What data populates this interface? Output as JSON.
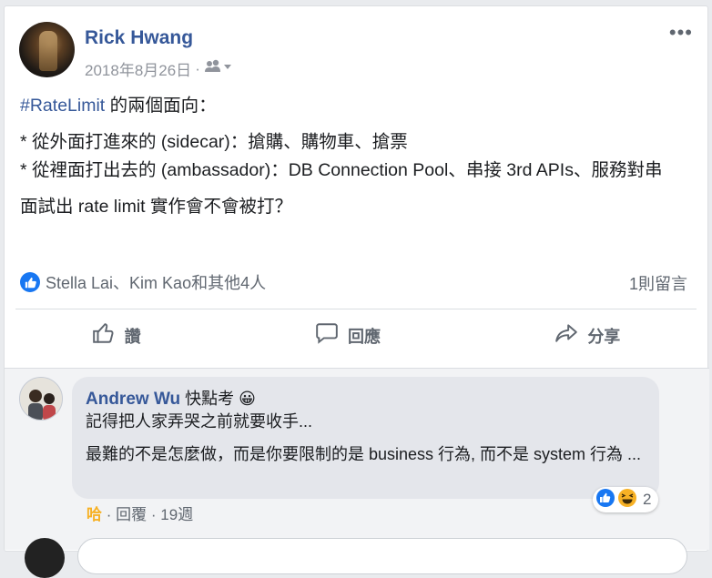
{
  "post": {
    "author": "Rick Hwang",
    "date": "2018年8月26日",
    "meta_sep": "·",
    "more": "•••",
    "hashtag": "#RateLimit",
    "line1_rest": " 的兩個面向：",
    "line2": "* 從外面打進來的 (sidecar)：搶購、購物車、搶票",
    "line3": "* 從裡面打出去的 (ambassador)：DB Connection Pool、串接 3rd APIs、服務對串",
    "line4": "面試出 rate limit 實作會不會被打？",
    "reactions_text": "Stella Lai、Kim Kao和其他4人",
    "comments_count": "1則留言"
  },
  "actions": {
    "like": "讚",
    "comment": "回應",
    "share": "分享"
  },
  "comment": {
    "author": "Andrew Wu",
    "status": " 快點考 😀",
    "line1": "記得把人家弄哭之前就要收手...",
    "line2": "最難的不是怎麼做，而是你要限制的是 business 行為, 而不是 system 行為 ...",
    "reaction_count": "2",
    "haha": "哈",
    "reply": "回覆",
    "time": "19週",
    "sep": "·"
  },
  "colors": {
    "link": "#365899",
    "like_blue": "#1877f2",
    "haha_yellow": "#f7b125"
  }
}
